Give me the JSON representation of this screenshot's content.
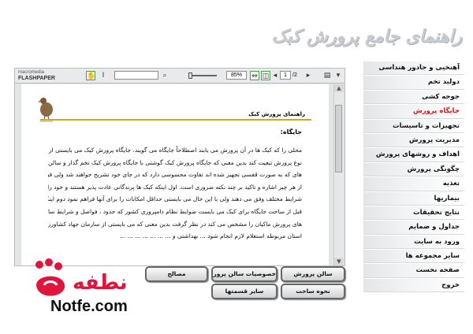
{
  "header": {
    "title": "راهنمای جامع پرورش کبک"
  },
  "viewer": {
    "logo_small": "macromedia",
    "logo_big": "FLASHPAPER",
    "zoom": "85%",
    "page": "1",
    "page_total": "/2"
  },
  "document": {
    "heading": "راهنمای پرورش کبک",
    "section_title": "جایگاه:",
    "lines": [
      "محلی را که کبک ها در آن پرورش می یابند اصطلاحاً جایگاه می گویند. جایگاه پرورش کبک می بایستی از",
      "نوع پرورش تبعیت کند بدین معنی که جایگاه پرورش کبک گوشتی با جایگاه پرورش کبک تخم گذار و سالن",
      "های که به صورت قفسی تجهیز شده اند تفاوت محسوسی دارد که در جای خود تشریح خواهند شد ولی قبل",
      "از هر چیز اشاره و تاکید بر چند نکته ضروری است. اول اینکه کبک ها پرندگانی عادت پذیر هستند و خود را با",
      "شرایط مختلف وفق می دهند ولی با این حال می بایستی حداقل امکانات را برای آنها فراهم نمود دوم اینکه",
      "قبل از ساخت جایگاه برای کبک می بایست ضوابط نظام دامپروری کشور که حدود ، فواصل و شرایط سالن",
      "های پرورش ماکیان را مشخص می کند در نظر گرفت بدین معنی که می بایستی از سازمان جهاد کشاورزی",
      "استان مربوطه استعلام لازم انجام شود ... بهداشتی و ... ... ... ... ... ... ..."
    ]
  },
  "menu": {
    "items": [
      {
        "label": "آهنخیی و جادور هنداسی",
        "active": false
      },
      {
        "label": "دولید تخم",
        "active": false
      },
      {
        "label": "جوجه کشی",
        "active": false
      },
      {
        "label": "جایگاه پرورش",
        "active": true
      },
      {
        "label": "تجهیزات و تاسیسات",
        "active": false
      },
      {
        "label": "مدیریت پرورش",
        "active": false
      },
      {
        "label": "اهداف و روشهای پرورش",
        "active": false
      },
      {
        "label": "چگونگی پرورش",
        "active": false
      },
      {
        "label": "تغذیه",
        "active": false
      },
      {
        "label": "بیماریها",
        "active": false
      },
      {
        "label": "نتایج تحقیقات",
        "active": false
      },
      {
        "label": "جداول و ضمایم",
        "active": false
      },
      {
        "label": "ورود به سایت",
        "active": false
      },
      {
        "label": "سایر مجموعه ها",
        "active": false
      },
      {
        "label": "صفحه نخست",
        "active": false
      },
      {
        "label": "خروج",
        "active": false
      }
    ]
  },
  "buttons": {
    "salon": "سالن پرورش",
    "khosusiat": "خصوصیات سالن پرورش",
    "masaleh": "مصالح",
    "nahve": "نحوه ساخت",
    "sayer": "سایر قسمتها"
  },
  "logo": {
    "fa": "نطفه",
    "en": "Notfe.com"
  },
  "colors": {
    "accent_red": "#d01818",
    "gold_rule": "#d9a520",
    "logo_red": "#e0143c"
  }
}
